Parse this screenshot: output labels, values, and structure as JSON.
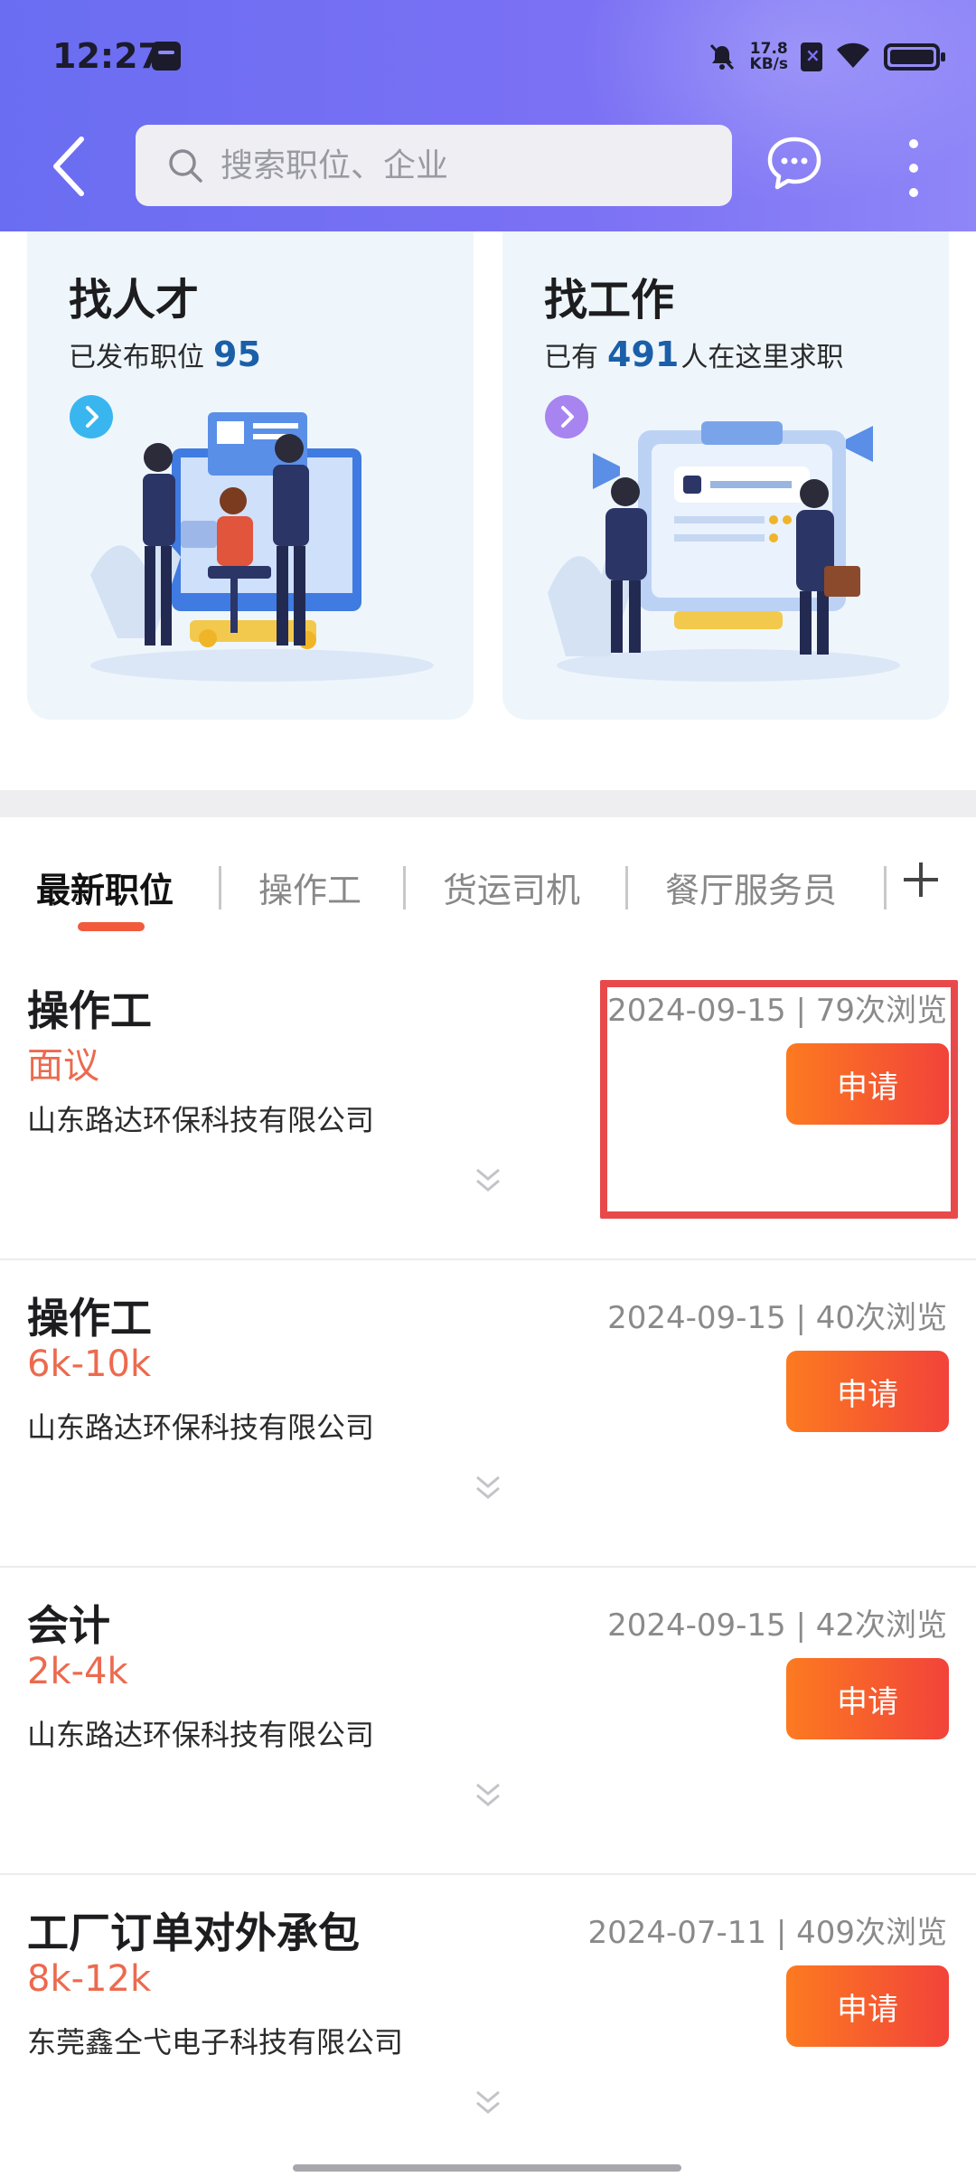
{
  "status_bar": {
    "time": "12:27",
    "net_speed_value": "17.8",
    "net_speed_unit": "KB/s"
  },
  "search": {
    "placeholder": "搜索职位、企业"
  },
  "cards": [
    {
      "title": "找人才",
      "sub_prefix": "已发布职位",
      "count": "95",
      "sub_suffix": "",
      "arrow_color": "#39b6f0"
    },
    {
      "title": "找工作",
      "sub_prefix": "已有",
      "count": "491",
      "sub_suffix": "人在这里求职",
      "arrow_color": "#a784f0"
    }
  ],
  "tabs": [
    "最新职位",
    "操作工",
    "货运司机",
    "餐厅服务员"
  ],
  "jobs": [
    {
      "title": "操作工",
      "salary": "面议",
      "company": "山东路达环保科技有限公司",
      "meta": "2024-09-15 | 79次浏览",
      "apply_label": "申请"
    },
    {
      "title": "操作工",
      "salary": "6k-10k",
      "company": "山东路达环保科技有限公司",
      "meta": "2024-09-15 | 40次浏览",
      "apply_label": "申请"
    },
    {
      "title": "会计",
      "salary": "2k-4k",
      "company": "山东路达环保科技有限公司",
      "meta": "2024-09-15 | 42次浏览",
      "apply_label": "申请"
    },
    {
      "title": "工厂订单对外承包",
      "salary": "8k-12k",
      "company": "东莞鑫仝弋电子科技有限公司",
      "meta": "2024-07-11 | 409次浏览",
      "apply_label": "申请"
    }
  ],
  "colors": {
    "header_gradient_start": "#6a6df2",
    "header_gradient_end": "#8f86f8",
    "accent": "#f25a3c",
    "salary": "#ec6a4e",
    "count_blue": "#1a5fa8",
    "highlight": "#e8494b"
  }
}
